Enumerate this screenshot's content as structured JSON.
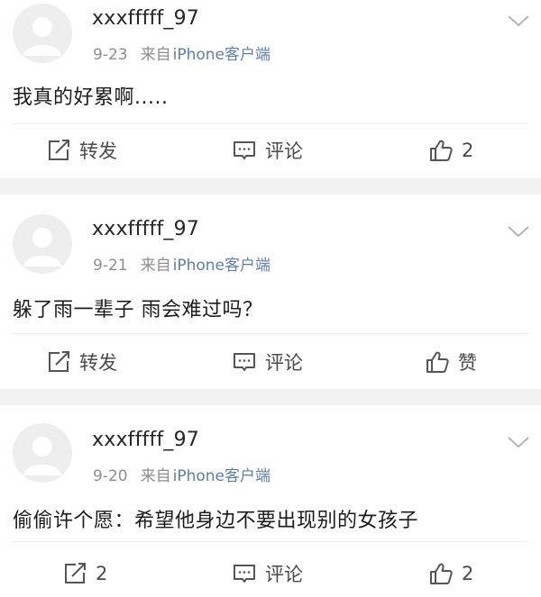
{
  "posts": [
    {
      "username": "xxxfffff_97",
      "date": "9-23",
      "from_label": "来自",
      "source": "iPhone客户端",
      "content": "我真的好累啊.....",
      "actions": {
        "repost_label": "转发",
        "comment_label": "评论",
        "like_label": "2"
      },
      "icons": {
        "more": "chevron-down-icon",
        "repost": "repost-icon",
        "comment": "comment-icon",
        "like": "thumbs-up-icon"
      }
    },
    {
      "username": "xxxfffff_97",
      "date": "9-21",
      "from_label": "来自",
      "source": "iPhone客户端",
      "content": "躲了雨一辈子 雨会难过吗？",
      "actions": {
        "repost_label": "转发",
        "comment_label": "评论",
        "like_label": "赞"
      },
      "icons": {
        "more": "chevron-down-icon",
        "repost": "repost-icon",
        "comment": "comment-icon",
        "like": "thumbs-up-icon"
      }
    },
    {
      "username": "xxxfffff_97",
      "date": "9-20",
      "from_label": "来自",
      "source": "iPhone客户端",
      "content": "偷偷许个愿：希望他身边不要出现别的女孩子",
      "actions": {
        "repost_label": "2",
        "comment_label": "评论",
        "like_label": "2"
      },
      "icons": {
        "more": "chevron-down-icon",
        "repost": "repost-icon",
        "comment": "comment-icon",
        "like": "thumbs-up-icon"
      }
    }
  ],
  "colors": {
    "separator": "#f2f2f2",
    "source_link": "#5f7fa5",
    "meta_text": "#8e8e8e",
    "icon_stroke": "#555555"
  }
}
